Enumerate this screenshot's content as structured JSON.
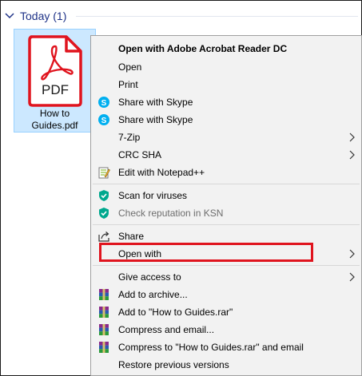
{
  "group": {
    "title": "Today (1)"
  },
  "file": {
    "name_line1": "How to",
    "name_line2": "Guides.pdf",
    "icon_text": "PDF"
  },
  "menu": {
    "items": [
      {
        "label": "Open with Adobe Acrobat Reader DC"
      },
      {
        "label": "Open"
      },
      {
        "label": "Print"
      },
      {
        "label": "Share with Skype"
      },
      {
        "label": "Share with Skype"
      },
      {
        "label": "7-Zip"
      },
      {
        "label": "CRC SHA"
      },
      {
        "label": "Edit with Notepad++"
      },
      {
        "label": "Scan for viruses"
      },
      {
        "label": "Check reputation in KSN"
      },
      {
        "label": "Share"
      },
      {
        "label": "Open with"
      },
      {
        "label": "Give access to"
      },
      {
        "label": "Add to archive..."
      },
      {
        "label": "Add to \"How to Guides.rar\""
      },
      {
        "label": "Compress and email..."
      },
      {
        "label": "Compress to \"How to Guides.rar\" and email"
      },
      {
        "label": "Restore previous versions"
      }
    ]
  },
  "colors": {
    "accent": "#1e3287",
    "selection": "#cce8ff",
    "pdf_red": "#e0141e",
    "highlight_box": "#e0141e",
    "kaspersky_green": "#00a88e",
    "skype_blue": "#00aff0"
  },
  "icons": [
    "chevron-down-icon",
    "pdf-file-icon",
    "skype-icon",
    "notepadpp-icon",
    "shield-icon",
    "share-icon",
    "winrar-icon",
    "chevron-right-icon"
  ]
}
